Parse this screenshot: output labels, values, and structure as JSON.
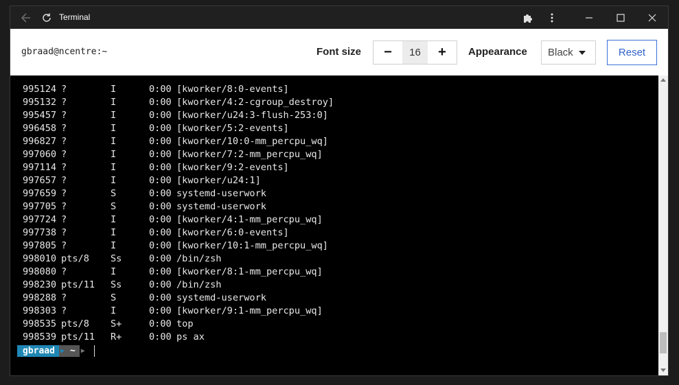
{
  "window": {
    "title": "Terminal"
  },
  "icons": {
    "back": "arrow-left-icon",
    "refresh": "refresh-icon",
    "extensions": "puzzle-icon",
    "menu": "kebab-menu-icon",
    "minimize": "minimize-icon",
    "maximize": "maximize-icon",
    "close": "close-icon"
  },
  "toolbar": {
    "host": "gbraad@ncentre:~",
    "font_size_label": "Font size",
    "font_size_minus": "−",
    "font_size_value": "16",
    "font_size_plus": "+",
    "appearance_label": "Appearance",
    "appearance_value": "Black",
    "reset_label": "Reset"
  },
  "processes": [
    {
      "pid": "995124",
      "tty": "?",
      "stat": "I",
      "time": "0:00",
      "cmd": "[kworker/8:0-events]"
    },
    {
      "pid": "995132",
      "tty": "?",
      "stat": "I",
      "time": "0:00",
      "cmd": "[kworker/4:2-cgroup_destroy]"
    },
    {
      "pid": "995457",
      "tty": "?",
      "stat": "I",
      "time": "0:00",
      "cmd": "[kworker/u24:3-flush-253:0]"
    },
    {
      "pid": "996458",
      "tty": "?",
      "stat": "I",
      "time": "0:00",
      "cmd": "[kworker/5:2-events]"
    },
    {
      "pid": "996827",
      "tty": "?",
      "stat": "I",
      "time": "0:00",
      "cmd": "[kworker/10:0-mm_percpu_wq]"
    },
    {
      "pid": "997060",
      "tty": "?",
      "stat": "I",
      "time": "0:00",
      "cmd": "[kworker/7:2-mm_percpu_wq]"
    },
    {
      "pid": "997114",
      "tty": "?",
      "stat": "I",
      "time": "0:00",
      "cmd": "[kworker/9:2-events]"
    },
    {
      "pid": "997657",
      "tty": "?",
      "stat": "I",
      "time": "0:00",
      "cmd": "[kworker/u24:1]"
    },
    {
      "pid": "997659",
      "tty": "?",
      "stat": "S",
      "time": "0:00",
      "cmd": "systemd-userwork"
    },
    {
      "pid": "997705",
      "tty": "?",
      "stat": "S",
      "time": "0:00",
      "cmd": "systemd-userwork"
    },
    {
      "pid": "997724",
      "tty": "?",
      "stat": "I",
      "time": "0:00",
      "cmd": "[kworker/4:1-mm_percpu_wq]"
    },
    {
      "pid": "997738",
      "tty": "?",
      "stat": "I",
      "time": "0:00",
      "cmd": "[kworker/6:0-events]"
    },
    {
      "pid": "997805",
      "tty": "?",
      "stat": "I",
      "time": "0:00",
      "cmd": "[kworker/10:1-mm_percpu_wq]"
    },
    {
      "pid": "998010",
      "tty": "pts/8",
      "stat": "Ss",
      "time": "0:00",
      "cmd": "/bin/zsh"
    },
    {
      "pid": "998080",
      "tty": "?",
      "stat": "I",
      "time": "0:00",
      "cmd": "[kworker/8:1-mm_percpu_wq]"
    },
    {
      "pid": "998230",
      "tty": "pts/11",
      "stat": "Ss",
      "time": "0:00",
      "cmd": "/bin/zsh"
    },
    {
      "pid": "998288",
      "tty": "?",
      "stat": "S",
      "time": "0:00",
      "cmd": "systemd-userwork"
    },
    {
      "pid": "998303",
      "tty": "?",
      "stat": "I",
      "time": "0:00",
      "cmd": "[kworker/9:1-mm_percpu_wq]"
    },
    {
      "pid": "998535",
      "tty": "pts/8",
      "stat": "S+",
      "time": "0:00",
      "cmd": "top"
    },
    {
      "pid": "998539",
      "tty": "pts/11",
      "stat": "R+",
      "time": "0:00",
      "cmd": "ps ax"
    }
  ],
  "prompt": {
    "user": "gbraad",
    "dir": "~"
  },
  "colors": {
    "prompt_user_bg": "#1f87b5",
    "prompt_dir_bg": "#555555",
    "reset_accent": "#2f62c9"
  }
}
